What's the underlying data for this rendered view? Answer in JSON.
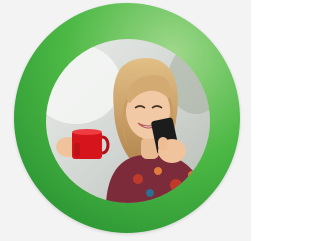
{
  "colors": {
    "background": "#f3f3f3",
    "ring_light": "#9fd88b",
    "ring_mid": "#4cb844",
    "ring_dark": "#1f8a2e",
    "mug": "#d6141c",
    "phone": "#1c1c1c",
    "hair": "#d3ab72",
    "skin": "#f1c9a4",
    "top_pattern": "#c0392b"
  },
  "icons": {
    "profile_image": "woman-smiling-with-red-mug-and-phone"
  }
}
